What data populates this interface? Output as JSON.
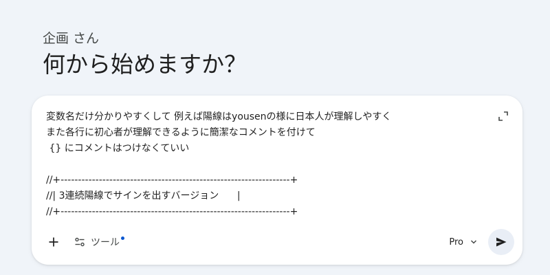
{
  "greeting": {
    "name": "企画 さん",
    "title": "何から始めますか？"
  },
  "prompt": {
    "lines": [
      "変数名だけ分かりやすくして 例えば陽線はyousenの様に日本人が理解しやすく",
      "また各行に初心者が理解できるように簡潔なコメントを付けて",
      " {} にコメントはつけなくていい",
      "",
      "//+------------------------------------------------------------------+",
      "//| 3連続陽線でサインを出すバージョン      |",
      "//+------------------------------------------------------------------+"
    ]
  },
  "toolbar": {
    "tools_label": "ツール",
    "model_label": "Pro"
  },
  "icons": {
    "expand": "expand-icon",
    "add": "plus-icon",
    "tools": "tools-icon",
    "model_chevron": "chevron-down-icon",
    "send": "send-icon"
  },
  "colors": {
    "background": "#f0f4f9",
    "card": "#ffffff",
    "accent_dot": "#0b57d0",
    "send_bg": "#e9eef6"
  }
}
